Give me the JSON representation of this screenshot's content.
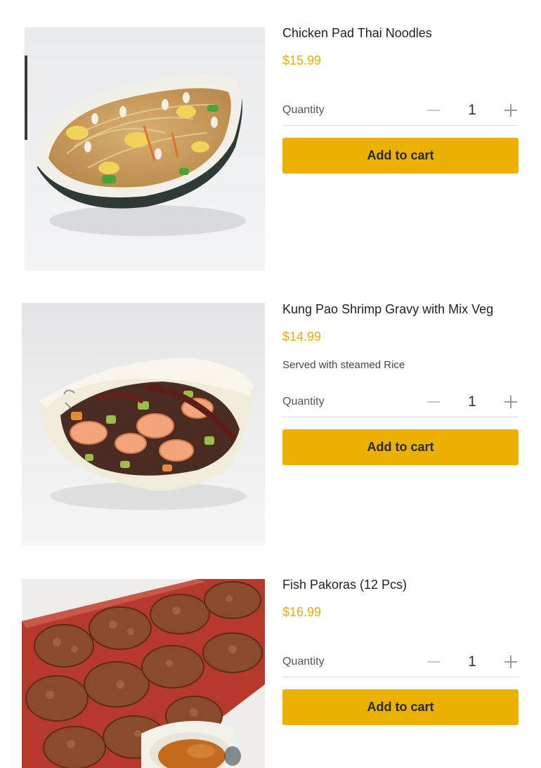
{
  "quantity_label": "Quantity",
  "add_to_cart_label": "Add to cart",
  "accent_color": "#ecb000",
  "price_color": "#e0ad12",
  "icons": {
    "minus": "minus-icon",
    "plus": "plus-icon"
  },
  "products": [
    {
      "name": "Chicken Pad Thai Noodles",
      "price": "$15.99",
      "description": "",
      "quantity": "1"
    },
    {
      "name": "Kung Pao Shrimp Gravy with Mix Veg",
      "price": "$14.99",
      "description": "Served with steamed Rice",
      "quantity": "1"
    },
    {
      "name": "Fish Pakoras (12 Pcs)",
      "price": "$16.99",
      "description": "",
      "quantity": "1"
    }
  ]
}
